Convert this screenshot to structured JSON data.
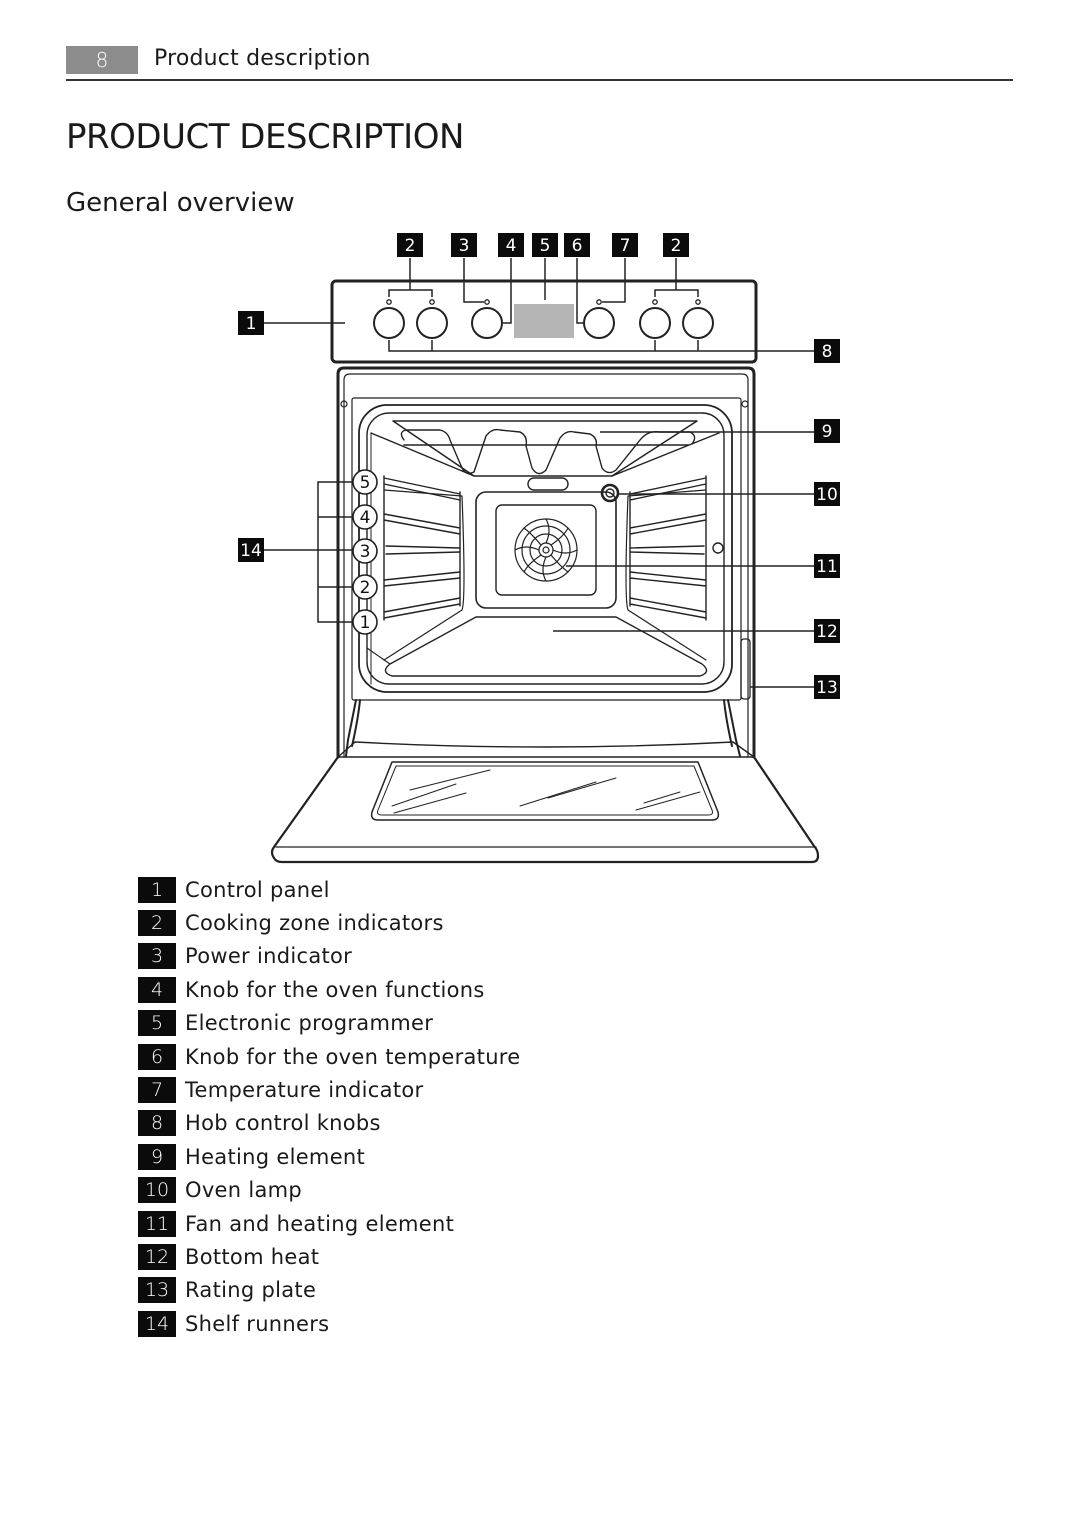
{
  "header": {
    "page_number": "8",
    "section": "Product description"
  },
  "page_title": "PRODUCT DESCRIPTION",
  "section_title": "General overview",
  "diagram": {
    "subject": "built-in oven with control panel, open door",
    "top_callouts": [
      "2",
      "3",
      "4",
      "5",
      "6",
      "7",
      "2"
    ],
    "left_callouts": [
      "1",
      "14"
    ],
    "right_callouts": [
      "8",
      "9",
      "10",
      "11",
      "12",
      "13"
    ],
    "shelf_levels": [
      "5",
      "4",
      "3",
      "2",
      "1"
    ]
  },
  "legend": [
    {
      "num": "1",
      "label": "Control panel"
    },
    {
      "num": "2",
      "label": "Cooking zone indicators"
    },
    {
      "num": "3",
      "label": "Power indicator"
    },
    {
      "num": "4",
      "label": "Knob for the oven functions"
    },
    {
      "num": "5",
      "label": "Electronic programmer"
    },
    {
      "num": "6",
      "label": "Knob for the oven temperature"
    },
    {
      "num": "7",
      "label": "Temperature indicator"
    },
    {
      "num": "8",
      "label": "Hob control knobs"
    },
    {
      "num": "9",
      "label": "Heating element"
    },
    {
      "num": "10",
      "label": "Oven lamp"
    },
    {
      "num": "11",
      "label": "Fan and heating element"
    },
    {
      "num": "12",
      "label": "Bottom heat"
    },
    {
      "num": "13",
      "label": "Rating plate"
    },
    {
      "num": "14",
      "label": "Shelf runners"
    }
  ]
}
